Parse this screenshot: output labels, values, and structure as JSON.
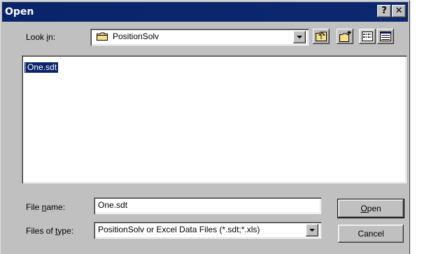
{
  "window": {
    "title": "Open",
    "help_glyph": "?",
    "close_glyph": "✕"
  },
  "look_in": {
    "label_pre": "Look ",
    "label_key": "i",
    "label_post": "n:",
    "value": "PositionSolv",
    "icon": "folder-icon"
  },
  "toolbar": {
    "icons": [
      "up-one-level-icon",
      "new-folder-icon",
      "list-view-icon",
      "details-view-icon"
    ]
  },
  "files": [
    {
      "name": "One.sdt",
      "selected": true,
      "icon": "data-file-icon"
    }
  ],
  "file_name": {
    "label_pre": "File ",
    "label_key": "n",
    "label_post": "ame:",
    "value": "One.sdt"
  },
  "file_type": {
    "label_pre": "Files of ",
    "label_key": "t",
    "label_post": "ype:",
    "value": "PositionSolv or Excel Data Files (*.sdt;*.xls)"
  },
  "buttons": {
    "open_key": "O",
    "open_rest": "pen",
    "cancel": "Cancel"
  },
  "colors": {
    "title_bar": "#0a246a",
    "face": "#c0c0c0",
    "selection": "#0a246a"
  }
}
